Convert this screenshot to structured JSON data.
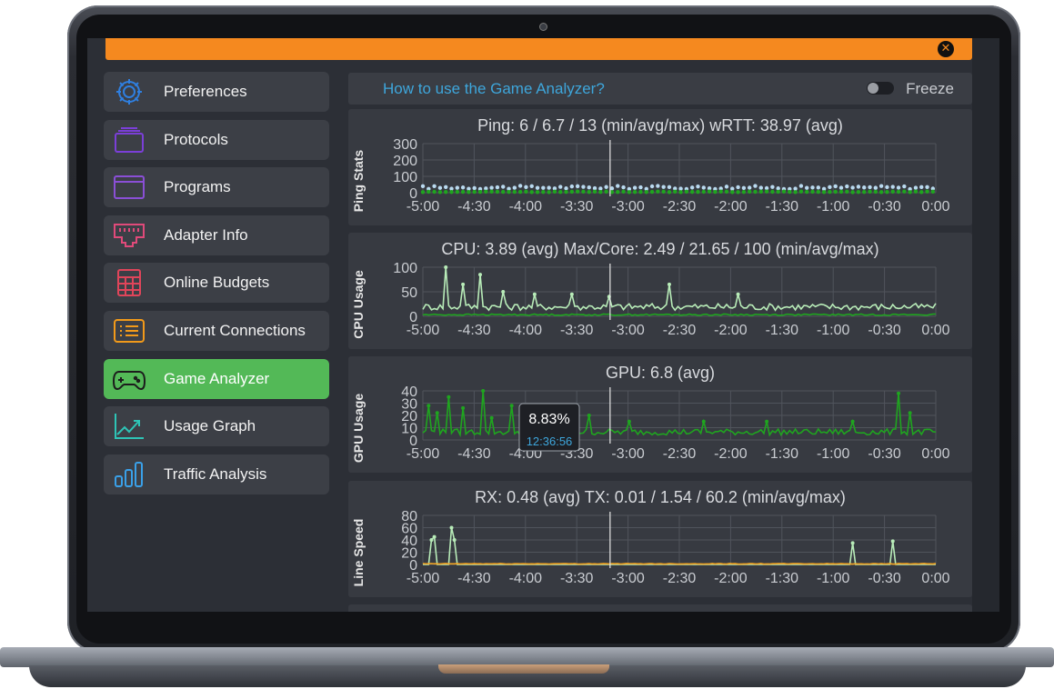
{
  "topbar": {
    "close_icon": "close-icon"
  },
  "sidebar": {
    "items": [
      {
        "label": "Preferences",
        "icon": "gear-icon",
        "color": "#2f7fe0"
      },
      {
        "label": "Protocols",
        "icon": "layers-icon",
        "color": "#7b3fd8"
      },
      {
        "label": "Programs",
        "icon": "window-icon",
        "color": "#8a4fd6"
      },
      {
        "label": "Adapter Info",
        "icon": "ethernet-icon",
        "color": "#e04a7a"
      },
      {
        "label": "Online Budgets",
        "icon": "calculator-icon",
        "color": "#e0455a"
      },
      {
        "label": "Current Connections",
        "icon": "list-icon",
        "color": "#f29a1a"
      },
      {
        "label": "Game Analyzer",
        "icon": "gamepad-icon",
        "color": "#1c1c1c",
        "active": true
      },
      {
        "label": "Usage Graph",
        "icon": "trend-icon",
        "color": "#2ec4b6"
      },
      {
        "label": "Traffic Analysis",
        "icon": "bars-icon",
        "color": "#3aa0e8"
      }
    ]
  },
  "main": {
    "help_link": "How to use the Game Analyzer?",
    "freeze_label": "Freeze",
    "freeze_on": false
  },
  "chart_data": [
    {
      "type": "scatter",
      "title": "Ping: 6 / 6.7 / 13 (min/avg/max)     wRTT: 38.97 (avg)",
      "ylabel": "Ping Stats",
      "yticks": [
        "300",
        "200",
        "100",
        "0"
      ],
      "ylim": [
        0,
        300
      ],
      "xticks": [
        "-5:00",
        "-4:30",
        "-4:00",
        "-3:30",
        "-3:00",
        "-2:30",
        "-2:00",
        "-1:30",
        "-1:00",
        "-0:30",
        "0:00"
      ],
      "series": [
        {
          "color": "#b9d9ef",
          "base": 30,
          "noise": 20,
          "spikes": [
            [
              7,
              210
            ]
          ]
        },
        {
          "color": "#1fa51f",
          "base": 5,
          "noise": 4,
          "spikes": []
        }
      ],
      "cursor": 0.7
    },
    {
      "type": "line",
      "title": "CPU: 3.89 (avg)     Max/Core: 2.49 / 21.65 / 100 (min/avg/max)",
      "ylabel": "CPU Usage",
      "yticks": [
        "100",
        "50",
        "0"
      ],
      "ylim": [
        0,
        100
      ],
      "xticks": [
        "-5:00",
        "-4:30",
        "-4:00",
        "-3:30",
        "-3:00",
        "-2:30",
        "-2:00",
        "-1:30",
        "-1:00",
        "-0:30",
        "0:00"
      ],
      "series": [
        {
          "color": "#b8ecb8",
          "base": 18,
          "noise": 14,
          "spikes": [
            [
              8,
              100
            ],
            [
              14,
              65
            ],
            [
              20,
              85
            ],
            [
              28,
              50
            ],
            [
              39,
              45
            ],
            [
              52,
              45
            ],
            [
              65,
              40
            ],
            [
              86,
              65
            ],
            [
              110,
              45
            ]
          ]
        },
        {
          "color": "#1fa51f",
          "base": 3,
          "noise": 3,
          "spikes": []
        }
      ],
      "cursor": 0.7
    },
    {
      "type": "line",
      "title": "GPU: 6.8 (avg)",
      "ylabel": "GPU Usage",
      "yticks": [
        "40",
        "30",
        "20",
        "10",
        "0"
      ],
      "ylim": [
        0,
        40
      ],
      "xticks": [
        "-5:00",
        "-4:30",
        "-4:00",
        "-3:30",
        "-3:00",
        "-2:30",
        "-2:00",
        "-1:30",
        "-1:00",
        "-0:30",
        "0:00"
      ],
      "series": [
        {
          "color": "#1fa51f",
          "base": 6,
          "noise": 5,
          "spikes": [
            [
              2,
              28
            ],
            [
              5,
              22
            ],
            [
              9,
              35
            ],
            [
              14,
              26
            ],
            [
              21,
              40
            ],
            [
              24,
              18
            ],
            [
              31,
              28
            ],
            [
              36,
              20
            ],
            [
              40,
              25
            ],
            [
              47,
              22
            ],
            [
              58,
              20
            ],
            [
              72,
              15
            ],
            [
              98,
              15
            ],
            [
              120,
              15
            ],
            [
              150,
              15
            ],
            [
              166,
              38
            ],
            [
              170,
              22
            ]
          ]
        }
      ],
      "tooltip": {
        "value": "8.83%",
        "time": "12:36:56"
      },
      "cursor": 0.7
    },
    {
      "type": "line",
      "title": "RX: 0.48 (avg)     TX: 0.01 / 1.54 / 60.2 (min/avg/max)",
      "ylabel": "Line Speed",
      "yticks": [
        "80",
        "60",
        "40",
        "20",
        "0"
      ],
      "ylim": [
        0,
        80
      ],
      "xticks": [
        "-5:00",
        "-4:30",
        "-4:00",
        "-3:30",
        "-3:00",
        "-2:30",
        "-2:00",
        "-1:30",
        "-1:00",
        "-0:30",
        "0:00"
      ],
      "series": [
        {
          "color": "#b8ecb8",
          "base": 0,
          "noise": 0,
          "spikes": [
            [
              3,
              40
            ],
            [
              4,
              45
            ],
            [
              10,
              60
            ],
            [
              11,
              40
            ],
            [
              150,
              35
            ],
            [
              164,
              38
            ]
          ]
        },
        {
          "color": "#f5a623",
          "base": 1,
          "noise": 1,
          "spikes": []
        }
      ],
      "cursor": 0.7
    }
  ]
}
